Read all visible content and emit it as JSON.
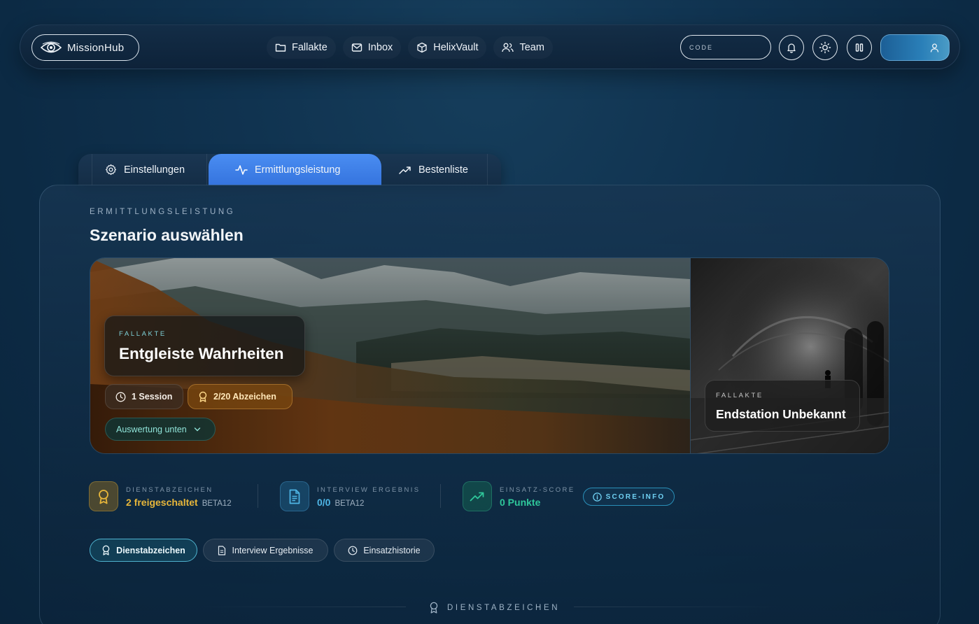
{
  "header": {
    "logo_text": "MissionHub",
    "nav": [
      {
        "label": "Fallakte",
        "icon": "folder-icon"
      },
      {
        "label": "Inbox",
        "icon": "mail-icon"
      },
      {
        "label": "HelixVault",
        "icon": "cube-icon"
      },
      {
        "label": "Team",
        "icon": "users-icon"
      }
    ],
    "code_placeholder": "CODE",
    "icons": [
      "bell-icon",
      "sun-icon",
      "pause-icon",
      "user-icon"
    ]
  },
  "tabs": [
    {
      "label": "Einstellungen",
      "icon": "gear-icon",
      "active": false
    },
    {
      "label": "Ermittlungsleistung",
      "icon": "activity-icon",
      "active": true
    },
    {
      "label": "Bestenliste",
      "icon": "trending-up-icon",
      "active": false
    }
  ],
  "main": {
    "eyebrow": "ERMITTLUNGSLEISTUNG",
    "title": "Szenario auswählen",
    "scenarios": [
      {
        "eyebrow": "FALLAKTE",
        "title": "Entgleiste Wahrheiten",
        "session_chip": "1 Session",
        "badges_chip": "2/20 Abzeichen",
        "eval_button": "Auswertung unten"
      },
      {
        "eyebrow": "FALLAKTE",
        "title": "Endstation Unbekannt"
      }
    ],
    "stats": [
      {
        "label": "DIENSTABZEICHEN",
        "value": "2 freigeschaltet",
        "beta": "BETA12",
        "color": "#e7b63a",
        "icon": "award-icon"
      },
      {
        "label": "INTERVIEW ERGEBNIS",
        "value": "0/0",
        "beta": "BETA12",
        "color": "#4fb6e6",
        "icon": "document-icon"
      },
      {
        "label": "EINSATZ-SCORE",
        "value": "0 Punkte",
        "beta": "",
        "color": "#2fc79a",
        "icon": "trending-up-icon"
      }
    ],
    "score_info": "SCORE-INFO",
    "filters": [
      {
        "label": "Dienstabzeichen",
        "icon": "award-icon",
        "active": true
      },
      {
        "label": "Interview Ergebnisse",
        "icon": "document-icon",
        "active": false
      },
      {
        "label": "Einsatzhistorie",
        "icon": "clock-icon",
        "active": false
      }
    ],
    "section_title": "DIENSTABZEICHEN"
  }
}
